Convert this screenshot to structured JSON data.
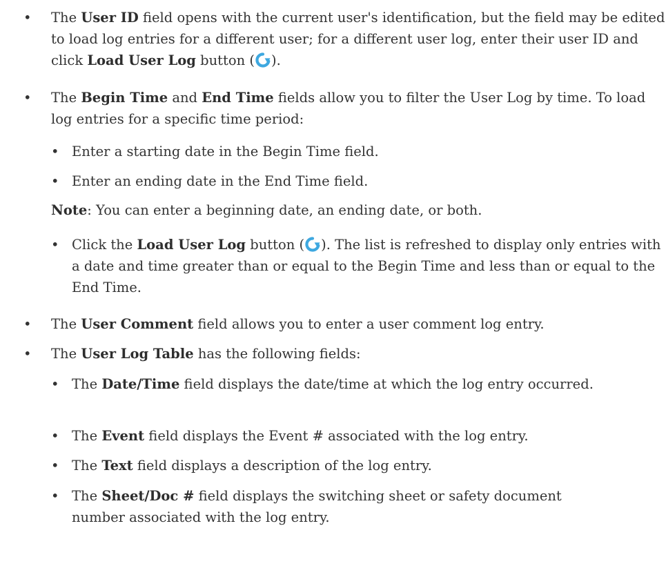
{
  "colors": {
    "text": "#333333",
    "icon": "#3ea8e0"
  },
  "icon_name": "refresh-icon",
  "bullet": "•",
  "punct": {
    "open_paren": "(",
    "close_paren_period": ").",
    "close_paren_period_space": "). ",
    "colon": ":"
  },
  "items": [
    {
      "p1": "The ",
      "b1": "User ID",
      "p2": " field opens with the current user's identification, but the field may be edited to load log entries for a different user; for a different user log, enter their user ID and click ",
      "b2": "Load User Log",
      "p3": " button "
    },
    {
      "p1": "The ",
      "b1": "Begin Time",
      "p2": " and ",
      "b2": "End Time",
      "p3": " fields allow you to filter the User Log by time. To load log entries for a specific time period:"
    }
  ],
  "sub_begin": "Enter a starting date in the Begin Time field.",
  "sub_end": "Enter an ending date in the End Time field.",
  "note": {
    "label": "Note",
    "text": ": You can enter a beginning date, an ending date, or both."
  },
  "load_step": {
    "p1": "Click the ",
    "b1": "Load User Log",
    "p2": " button ",
    "p3": "The list is refreshed to display only entries with a date and time greater than or equal to the Begin Time and less than or equal to the End Time."
  },
  "user_comment": {
    "p1": "The ",
    "b1": "User Comment",
    "p2": " field allows you to enter a user comment log entry."
  },
  "user_log_table": {
    "p1": "The ",
    "b1": "User Log Table",
    "p2": " has the following fields:"
  },
  "fields": [
    {
      "p1": "The ",
      "b1": "Date/Time",
      "p2": " field displays the date/time at which the log entry occurred."
    },
    {
      "p1": "The ",
      "b1": "Event",
      "p2": " field displays the Event # associated with the log entry."
    },
    {
      "p1": "The ",
      "b1": "Text",
      "p2": " field displays a description of the log entry."
    },
    {
      "p1": "The ",
      "b1": "Sheet/Doc #",
      "p2": " field displays the switching sheet or safety document number associated with the log entry."
    }
  ]
}
